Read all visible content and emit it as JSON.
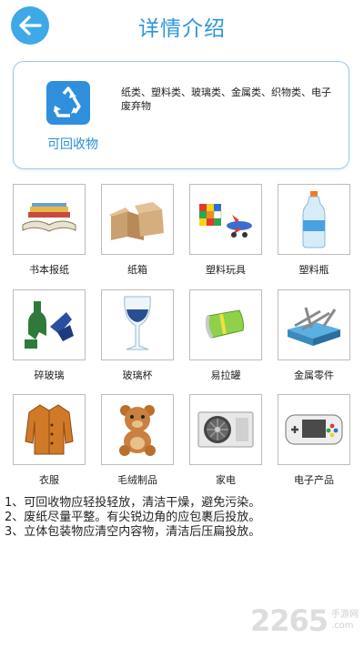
{
  "header": {
    "title": "详情介绍"
  },
  "category": {
    "label": "可回收物",
    "description": "纸类、塑料类、玻璃类、金属类、织物类、电子废弃物"
  },
  "items": [
    {
      "label": "书本报纸",
      "icon": "books-newspaper-image"
    },
    {
      "label": "纸箱",
      "icon": "cardboard-boxes-image"
    },
    {
      "label": "塑料玩具",
      "icon": "plastic-toys-image"
    },
    {
      "label": "塑料瓶",
      "icon": "plastic-bottle-image"
    },
    {
      "label": "碎玻璃",
      "icon": "broken-glass-image"
    },
    {
      "label": "玻璃杯",
      "icon": "wine-glass-image"
    },
    {
      "label": "易拉罐",
      "icon": "can-image"
    },
    {
      "label": "金属零件",
      "icon": "metal-parts-image"
    },
    {
      "label": "衣服",
      "icon": "clothes-image"
    },
    {
      "label": "毛绒制品",
      "icon": "plush-toy-image"
    },
    {
      "label": "家电",
      "icon": "appliance-image"
    },
    {
      "label": "电子产品",
      "icon": "electronics-image"
    }
  ],
  "tips": [
    "1、可回收物应轻投轻放，清洁干燥，避免污染。",
    "2、废纸尽量平整。有尖锐边角的应包裹后投放。",
    "3、立体包装物应清空内容物，清洁后压扁投放。"
  ],
  "watermark": {
    "number": "2265",
    "sub1": "手游网",
    "sub2": ".com"
  },
  "colors": {
    "accent": "#2a96dc",
    "back_button": "#3fa8e6",
    "card_border": "#9cc8ee"
  }
}
